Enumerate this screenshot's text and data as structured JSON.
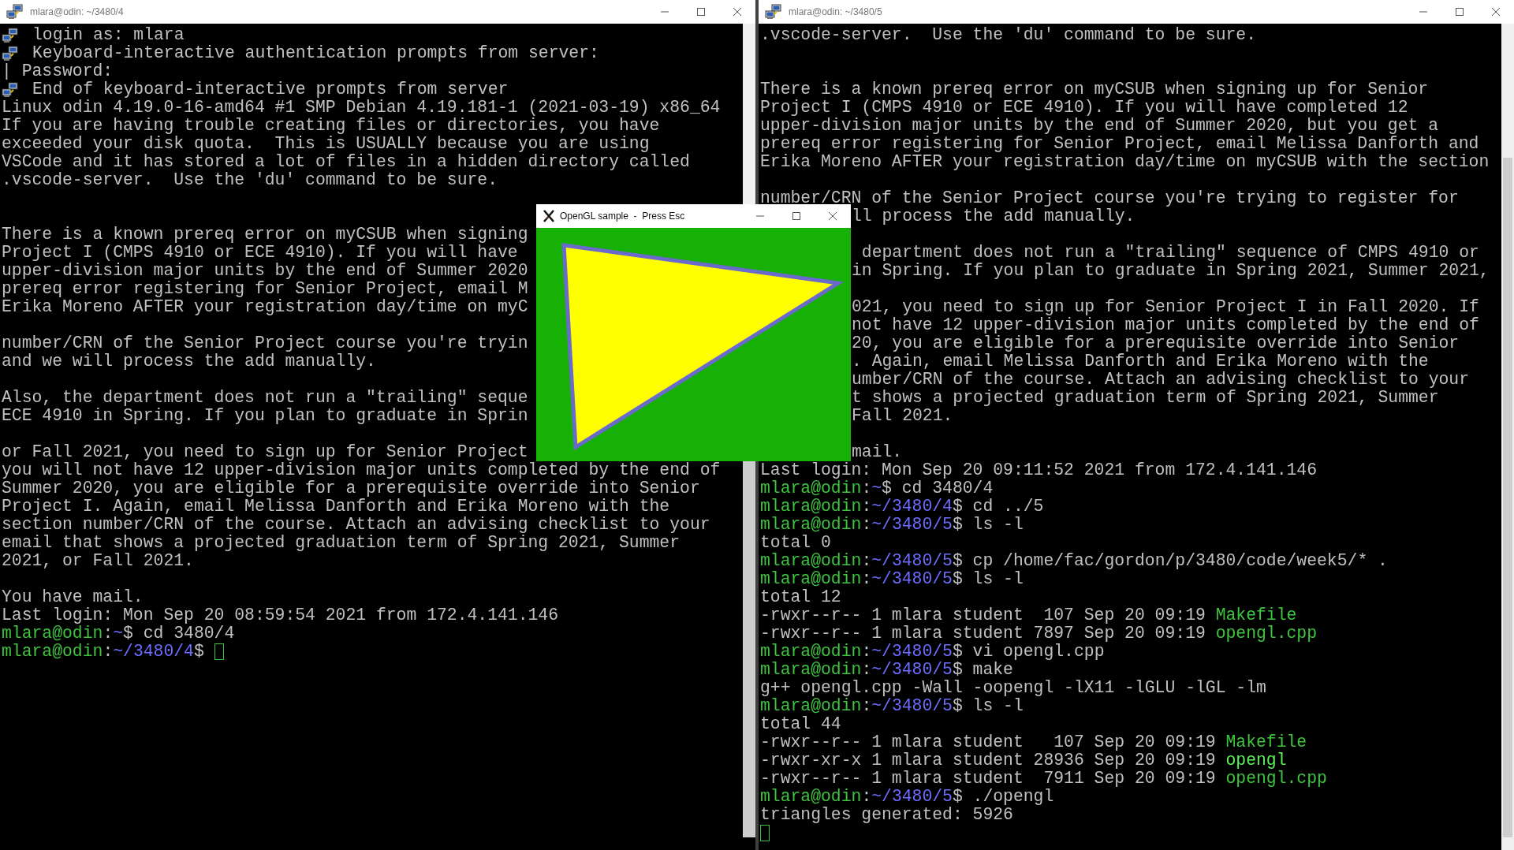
{
  "terminals": [
    {
      "title": "mlara@odin: ~/3480/4",
      "lines": [
        {
          "kind": "putty",
          "text": "login as: mlara"
        },
        {
          "kind": "putty",
          "text": "Keyboard-interactive authentication prompts from server:"
        },
        {
          "kind": "text",
          "text": "| Password:"
        },
        {
          "kind": "putty",
          "text": "End of keyboard-interactive prompts from server"
        },
        {
          "kind": "text",
          "text": "Linux odin 4.19.0-16-amd64 #1 SMP Debian 4.19.181-1 (2021-03-19) x86_64"
        },
        {
          "kind": "text",
          "text": "If you are having trouble creating files or directories, you have"
        },
        {
          "kind": "text",
          "text": "exceeded your disk quota.  This is USUALLY because you are using"
        },
        {
          "kind": "text",
          "text": "VSCode and it has stored a lot of files in a hidden directory called"
        },
        {
          "kind": "text",
          "text": ".vscode-server.  Use the 'du' command to be sure."
        },
        {
          "kind": "blank"
        },
        {
          "kind": "blank"
        },
        {
          "kind": "text",
          "text": "There is a known prereq error on myCSUB when signing"
        },
        {
          "kind": "text",
          "text": "Project I (CMPS 4910 or ECE 4910). If you will have"
        },
        {
          "kind": "text",
          "text": "upper-division major units by the end of Summer 2020"
        },
        {
          "kind": "text",
          "text": "prereq error registering for Senior Project, email M"
        },
        {
          "kind": "text",
          "text": "Erika Moreno AFTER your registration day/time on myC"
        },
        {
          "kind": "blank"
        },
        {
          "kind": "text",
          "text": "number/CRN of the Senior Project course you're tryin"
        },
        {
          "kind": "text",
          "text": "and we will process the add manually."
        },
        {
          "kind": "blank"
        },
        {
          "kind": "text",
          "text": "Also, the department does not run a \"trailing\" seque"
        },
        {
          "kind": "text",
          "text": "ECE 4910 in Spring. If you plan to graduate in Sprin"
        },
        {
          "kind": "blank"
        },
        {
          "kind": "text",
          "text": "or Fall 2021, you need to sign up for Senior Project"
        },
        {
          "kind": "text",
          "text": "you will not have 12 upper-division major units completed by the end of"
        },
        {
          "kind": "text",
          "text": "Summer 2020, you are eligible for a prerequisite override into Senior"
        },
        {
          "kind": "text",
          "text": "Project I. Again, email Melissa Danforth and Erika Moreno with the"
        },
        {
          "kind": "text",
          "text": "section number/CRN of the course. Attach an advising checklist to your"
        },
        {
          "kind": "text",
          "text": "email that shows a projected graduation term of Spring 2021, Summer"
        },
        {
          "kind": "text",
          "text": "2021, or Fall 2021."
        },
        {
          "kind": "blank"
        },
        {
          "kind": "text",
          "text": "You have mail."
        },
        {
          "kind": "text",
          "text": "Last login: Mon Sep 20 08:59:54 2021 from 172.4.141.146"
        },
        {
          "kind": "text",
          "parts": [
            {
              "kind": "user",
              "text": "mlara@odin"
            },
            {
              "kind": "plain",
              "text": ":"
            },
            {
              "kind": "path",
              "text": "~"
            },
            {
              "kind": "plain",
              "text": "$ cd 3480/4"
            }
          ]
        },
        {
          "kind": "text",
          "parts": [
            {
              "kind": "user",
              "text": "mlara@odin"
            },
            {
              "kind": "plain",
              "text": ":"
            },
            {
              "kind": "path",
              "text": "~/3480/4"
            },
            {
              "kind": "plain",
              "text": "$ "
            },
            {
              "kind": "cursor"
            }
          ]
        }
      ]
    },
    {
      "title": "mlara@odin: ~/3480/5",
      "lines": [
        {
          "kind": "text",
          "text": ".vscode-server.  Use the 'du' command to be sure."
        },
        {
          "kind": "blank"
        },
        {
          "kind": "blank"
        },
        {
          "kind": "text",
          "text": "There is a known prereq error on myCSUB when signing up for Senior"
        },
        {
          "kind": "text",
          "text": "Project I (CMPS 4910 or ECE 4910). If you will have completed 12"
        },
        {
          "kind": "text",
          "text": "upper-division major units by the end of Summer 2020, but you get a"
        },
        {
          "kind": "text",
          "text": "prereq error registering for Senior Project, email Melissa Danforth and"
        },
        {
          "kind": "text",
          "text": "Erika Moreno AFTER your registration day/time on myCSUB with the section"
        },
        {
          "kind": "blank"
        },
        {
          "kind": "text",
          "text": "number/CRN of the Senior Project course you're trying to register for"
        },
        {
          "kind": "clipped",
          "text": "ll process the add manually."
        },
        {
          "kind": "blank"
        },
        {
          "kind": "clipped",
          "text": " department does not run a \"trailing\" sequence of CMPS 4910 or"
        },
        {
          "kind": "clipped",
          "text": "in Spring. If you plan to graduate in Spring 2021, Summer 2021,"
        },
        {
          "kind": "blank"
        },
        {
          "kind": "clipped",
          "text": "021, you need to sign up for Senior Project I in Fall 2020. If"
        },
        {
          "kind": "clipped",
          "text": "not have 12 upper-division major units completed by the end of"
        },
        {
          "kind": "clipped",
          "text": "20, you are eligible for a prerequisite override into Senior"
        },
        {
          "kind": "clipped",
          "text": ". Again, email Melissa Danforth and Erika Moreno with the"
        },
        {
          "kind": "clipped",
          "text": "umber/CRN of the course. Attach an advising checklist to your"
        },
        {
          "kind": "clipped",
          "text": "t shows a projected graduation term of Spring 2021, Summer"
        },
        {
          "kind": "clipped",
          "text": "Fall 2021."
        },
        {
          "kind": "blank"
        },
        {
          "kind": "clipped",
          "text": "mail."
        },
        {
          "kind": "text",
          "text": "Last login: Mon Sep 20 09:11:52 2021 from 172.4.141.146"
        },
        {
          "kind": "text",
          "parts": [
            {
              "kind": "user",
              "text": "mlara@odin"
            },
            {
              "kind": "plain",
              "text": ":"
            },
            {
              "kind": "path",
              "text": "~"
            },
            {
              "kind": "plain",
              "text": "$ cd 3480/4"
            }
          ]
        },
        {
          "kind": "text",
          "parts": [
            {
              "kind": "user",
              "text": "mlara@odin"
            },
            {
              "kind": "plain",
              "text": ":"
            },
            {
              "kind": "path",
              "text": "~/3480/4"
            },
            {
              "kind": "plain",
              "text": "$ cd ../5"
            }
          ]
        },
        {
          "kind": "text",
          "parts": [
            {
              "kind": "user",
              "text": "mlara@odin"
            },
            {
              "kind": "plain",
              "text": ":"
            },
            {
              "kind": "path",
              "text": "~/3480/5"
            },
            {
              "kind": "plain",
              "text": "$ ls -l"
            }
          ]
        },
        {
          "kind": "text",
          "text": "total 0"
        },
        {
          "kind": "text",
          "parts": [
            {
              "kind": "user",
              "text": "mlara@odin"
            },
            {
              "kind": "plain",
              "text": ":"
            },
            {
              "kind": "path",
              "text": "~/3480/5"
            },
            {
              "kind": "plain",
              "text": "$ cp /home/fac/gordon/p/3480/code/week5/* ."
            }
          ]
        },
        {
          "kind": "text",
          "parts": [
            {
              "kind": "user",
              "text": "mlara@odin"
            },
            {
              "kind": "plain",
              "text": ":"
            },
            {
              "kind": "path",
              "text": "~/3480/5"
            },
            {
              "kind": "plain",
              "text": "$ ls -l"
            }
          ]
        },
        {
          "kind": "text",
          "text": "total 12"
        },
        {
          "kind": "text",
          "parts": [
            {
              "kind": "plain",
              "text": "-rwxr--r-- 1 mlara student  107 Sep 20 09:19 "
            },
            {
              "kind": "file",
              "text": "Makefile"
            }
          ]
        },
        {
          "kind": "text",
          "parts": [
            {
              "kind": "plain",
              "text": "-rwxr--r-- 1 mlara student 7897 Sep 20 09:19 "
            },
            {
              "kind": "file",
              "text": "opengl.cpp"
            }
          ]
        },
        {
          "kind": "text",
          "parts": [
            {
              "kind": "user",
              "text": "mlara@odin"
            },
            {
              "kind": "plain",
              "text": ":"
            },
            {
              "kind": "path",
              "text": "~/3480/5"
            },
            {
              "kind": "plain",
              "text": "$ vi opengl.cpp"
            }
          ]
        },
        {
          "kind": "text",
          "parts": [
            {
              "kind": "user",
              "text": "mlara@odin"
            },
            {
              "kind": "plain",
              "text": ":"
            },
            {
              "kind": "path",
              "text": "~/3480/5"
            },
            {
              "kind": "plain",
              "text": "$ make"
            }
          ]
        },
        {
          "kind": "text",
          "text": "g++ opengl.cpp -Wall -oopengl -lX11 -lGLU -lGL -lm"
        },
        {
          "kind": "text",
          "parts": [
            {
              "kind": "user",
              "text": "mlara@odin"
            },
            {
              "kind": "plain",
              "text": ":"
            },
            {
              "kind": "path",
              "text": "~/3480/5"
            },
            {
              "kind": "plain",
              "text": "$ ls -l"
            }
          ]
        },
        {
          "kind": "text",
          "text": "total 44"
        },
        {
          "kind": "text",
          "parts": [
            {
              "kind": "plain",
              "text": "-rwxr--r-- 1 mlara student   107 Sep 20 09:19 "
            },
            {
              "kind": "file",
              "text": "Makefile"
            }
          ]
        },
        {
          "kind": "text",
          "parts": [
            {
              "kind": "plain",
              "text": "-rwxr-xr-x 1 mlara student 28936 Sep 20 09:19 "
            },
            {
              "kind": "exec",
              "text": "opengl"
            }
          ]
        },
        {
          "kind": "text",
          "parts": [
            {
              "kind": "plain",
              "text": "-rwxr--r-- 1 mlara student  7911 Sep 20 09:19 "
            },
            {
              "kind": "file",
              "text": "opengl.cpp"
            }
          ]
        },
        {
          "kind": "text",
          "parts": [
            {
              "kind": "user",
              "text": "mlara@odin"
            },
            {
              "kind": "plain",
              "text": ":"
            },
            {
              "kind": "path",
              "text": "~/3480/5"
            },
            {
              "kind": "plain",
              "text": "$ ./opengl"
            }
          ]
        },
        {
          "kind": "text",
          "text": "triangles generated: 5926"
        },
        {
          "kind": "text",
          "parts": [
            {
              "kind": "cursor"
            }
          ]
        }
      ]
    }
  ],
  "gl_window": {
    "title": "OpenGL sample  -  Press Esc"
  }
}
